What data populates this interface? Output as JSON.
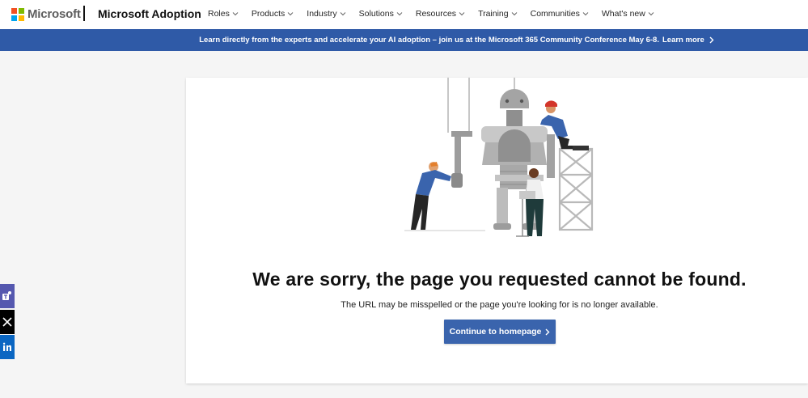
{
  "header": {
    "brand": "Microsoft",
    "site_title": "Microsoft Adoption",
    "logo_colors": [
      "#f25022",
      "#7fba00",
      "#00a4ef",
      "#ffb900"
    ],
    "nav": [
      {
        "label": "Roles"
      },
      {
        "label": "Products"
      },
      {
        "label": "Industry"
      },
      {
        "label": "Solutions"
      },
      {
        "label": "Resources"
      },
      {
        "label": "Training"
      },
      {
        "label": "Communities"
      },
      {
        "label": "What's new"
      }
    ]
  },
  "banner": {
    "text": "Learn directly from the experts and accelerate your AI adoption – join us at the Microsoft 365 Community Conference May 6-8.",
    "link": "Learn more",
    "color": "#2f5aa7"
  },
  "error": {
    "heading": "We are sorry, the page you requested cannot be found.",
    "subtext": "The URL may be misspelled or the page you're looking for is no longer available.",
    "cta": "Continue to homepage"
  },
  "share": {
    "icons": [
      "teams-icon",
      "x-icon",
      "linkedin-icon"
    ]
  }
}
